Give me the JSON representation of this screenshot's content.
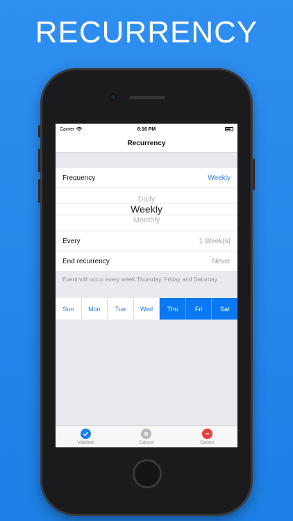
{
  "promo": {
    "title": "RECURRENCY"
  },
  "status": {
    "carrier": "Carrier",
    "time": "6:16 PM"
  },
  "nav": {
    "title": "Recurrency"
  },
  "frequency": {
    "label": "Frequency",
    "value": "Weekly",
    "picker_options": [
      "Daily",
      "Weekly",
      "Monthly"
    ],
    "selected": "Weekly"
  },
  "every": {
    "label": "Every",
    "value": "1 Week(s)"
  },
  "end": {
    "label": "End recurrency",
    "value": "Never"
  },
  "note": "Event will occur every week.Thursday, Friday and Saturday.",
  "days": [
    {
      "label": "Sun",
      "selected": false
    },
    {
      "label": "Mon",
      "selected": false
    },
    {
      "label": "Tue",
      "selected": false
    },
    {
      "label": "Wed",
      "selected": false
    },
    {
      "label": "Thu",
      "selected": true
    },
    {
      "label": "Fri",
      "selected": true
    },
    {
      "label": "Sat",
      "selected": true
    }
  ],
  "toolbar": {
    "validate": {
      "label": "Validate",
      "icon": "checkmark-icon",
      "color": "#1a7ef0"
    },
    "cancel": {
      "label": "Cancel",
      "icon": "close-icon",
      "color": "#b8b8bc"
    },
    "delete": {
      "label": "Delete",
      "icon": "minus-icon",
      "color": "#ef3b3b"
    }
  },
  "colors": {
    "accent": "#0a79f2",
    "background": "#2f8ff0"
  }
}
